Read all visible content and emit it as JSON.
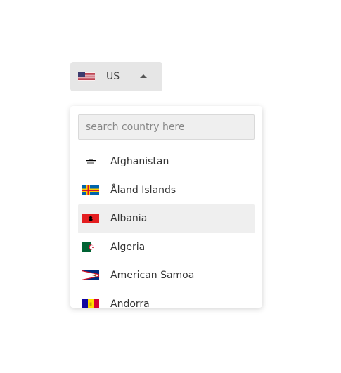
{
  "selector": {
    "flag_icon": "us-flag-icon",
    "code": "US",
    "caret_icon": "caret-up-icon"
  },
  "dropdown": {
    "search_placeholder": "search country here",
    "countries": [
      {
        "name": "Afghanistan",
        "flag_icon": "afghanistan-flag-icon",
        "selected": false
      },
      {
        "name": "Åland Islands",
        "flag_icon": "aland-islands-flag-icon",
        "selected": false
      },
      {
        "name": "Albania",
        "flag_icon": "albania-flag-icon",
        "selected": true
      },
      {
        "name": "Algeria",
        "flag_icon": "algeria-flag-icon",
        "selected": false
      },
      {
        "name": "American Samoa",
        "flag_icon": "american-samoa-flag-icon",
        "selected": false
      },
      {
        "name": "Andorra",
        "flag_icon": "andorra-flag-icon",
        "selected": false
      }
    ]
  }
}
